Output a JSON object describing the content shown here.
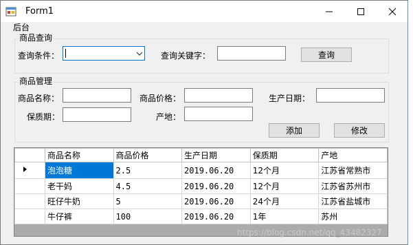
{
  "window": {
    "title": "Form1"
  },
  "menu": {
    "items": [
      "后台"
    ]
  },
  "query_group": {
    "title": "商品查询",
    "condition_label": "查询条件：",
    "condition_value": "",
    "keyword_label": "查询关键字：",
    "keyword_value": "",
    "query_button": "查询"
  },
  "manage_group": {
    "title": "商品管理",
    "name_label": "商品名称：",
    "price_label": "商品价格：",
    "date_label": "生产日期：",
    "shelf_label": "保质期：",
    "origin_label": "产地：",
    "add_button": "添加",
    "edit_button": "修改"
  },
  "grid": {
    "columns": [
      "商品名称",
      "商品价格",
      "生产日期",
      "保质期",
      "产地"
    ],
    "rows": [
      [
        "泡泡糖",
        "2.5",
        "2019.06.20",
        "12个月",
        "江苏省常熟市"
      ],
      [
        "老干妈",
        "4.5",
        "2019.06.20",
        "12个月",
        "江苏省苏州市"
      ],
      [
        "旺仔牛奶",
        "5",
        "2019.06.20",
        "24个月",
        "江苏省盐城市"
      ],
      [
        "牛仔裤",
        "100",
        "2019.06.20",
        "1年",
        "苏州"
      ]
    ]
  },
  "watermark": "https://blog.csdn.net/qq_43482327",
  "colors": {
    "selection": "#0078d7",
    "window_bg": "#f0f0f0"
  }
}
